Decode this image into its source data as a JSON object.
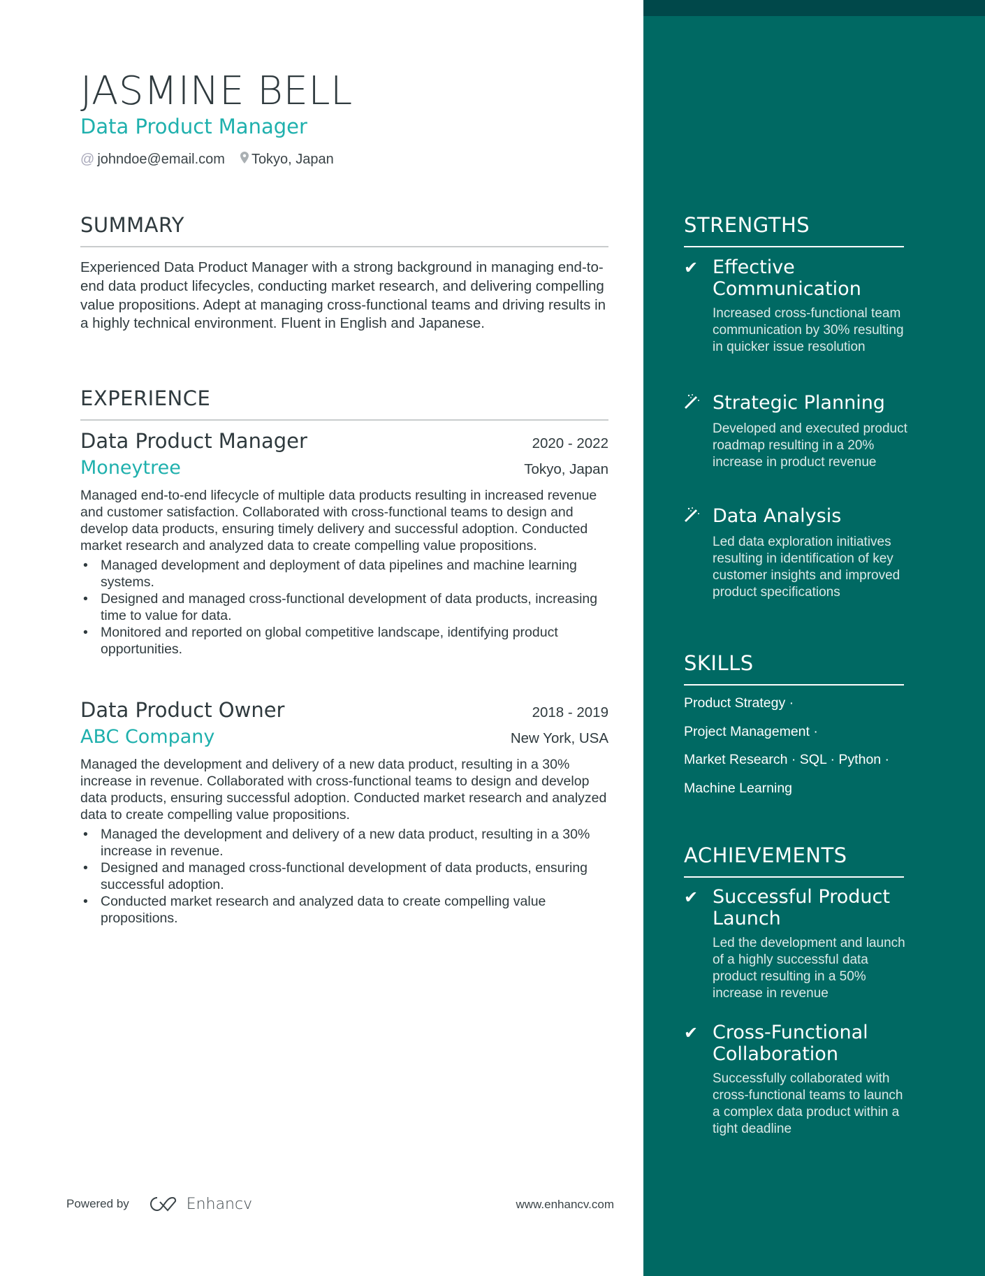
{
  "header": {
    "name": "JASMINE BELL",
    "title": "Data Product Manager",
    "email": "johndoe@email.com",
    "location": "Tokyo, Japan",
    "email_icon": "at-icon",
    "location_icon": "map-pin-icon"
  },
  "summary": {
    "heading": "SUMMARY",
    "text": "Experienced Data Product Manager with a strong background in managing end-to-end data product lifecycles, conducting market research, and delivering compelling value propositions. Adept at managing cross-functional teams and driving results in a highly technical environment. Fluent in English and Japanese."
  },
  "experience": {
    "heading": "EXPERIENCE",
    "jobs": [
      {
        "title": "Data Product Manager",
        "dates": "2020 - 2022",
        "company": "Moneytree",
        "location": "Tokyo, Japan",
        "description": "Managed end-to-end lifecycle of multiple data products resulting in increased revenue and customer satisfaction. Collaborated with cross-functional teams to design and develop data products, ensuring timely delivery and successful adoption. Conducted market research and analyzed data to create compelling value propositions.",
        "bullets": [
          "Managed development and deployment of data pipelines and machine learning systems.",
          "Designed and managed cross-functional development of data products, increasing time to value for data.",
          "Monitored and reported on global competitive landscape, identifying product opportunities."
        ]
      },
      {
        "title": "Data Product Owner",
        "dates": "2018 - 2019",
        "company": "ABC Company",
        "location": "New York, USA",
        "description": "Managed the development and delivery of a new data product, resulting in a 30% increase in revenue. Collaborated with cross-functional teams to design and develop data products, ensuring successful adoption. Conducted market research and analyzed data to create compelling value propositions.",
        "bullets": [
          "Managed the development and delivery of a new data product, resulting in a 30% increase in revenue.",
          "Designed and managed cross-functional development of data products, ensuring successful adoption.",
          "Conducted market research and analyzed data to create compelling value propositions."
        ]
      }
    ]
  },
  "strengths": {
    "heading": "STRENGTHS",
    "items": [
      {
        "icon": "check-icon",
        "title": "Effective Communication",
        "text": "Increased cross-functional team communication by 30% resulting in quicker issue resolution"
      },
      {
        "icon": "magic-wand-icon",
        "title": "Strategic Planning",
        "text": "Developed and executed product roadmap resulting in a 20% increase in product revenue"
      },
      {
        "icon": "magic-wand-icon",
        "title": "Data Analysis",
        "text": "Led data exploration initiatives resulting in identification of key customer insights and improved product specifications"
      }
    ]
  },
  "skills": {
    "heading": "SKILLS",
    "rows": [
      "Product Strategy ·",
      "Project Management ·",
      "Market Research · SQL · Python ·",
      "Machine Learning"
    ]
  },
  "achievements": {
    "heading": "ACHIEVEMENTS",
    "items": [
      {
        "icon": "check-icon",
        "title": "Successful Product Launch",
        "text": "Led the development and launch of a highly successful data product resulting in a 50% increase in revenue"
      },
      {
        "icon": "check-icon",
        "title": "Cross-Functional Collaboration",
        "text": "Successfully collaborated with cross-functional teams to launch a complex data product within a tight deadline"
      }
    ]
  },
  "footer": {
    "powered_by": "Powered by",
    "brand": "Enhancv",
    "url": "www.enhancv.com"
  },
  "colors": {
    "sidebar": "#006963",
    "sidebar_top": "#00484a",
    "accent": "#1fb0ad"
  }
}
